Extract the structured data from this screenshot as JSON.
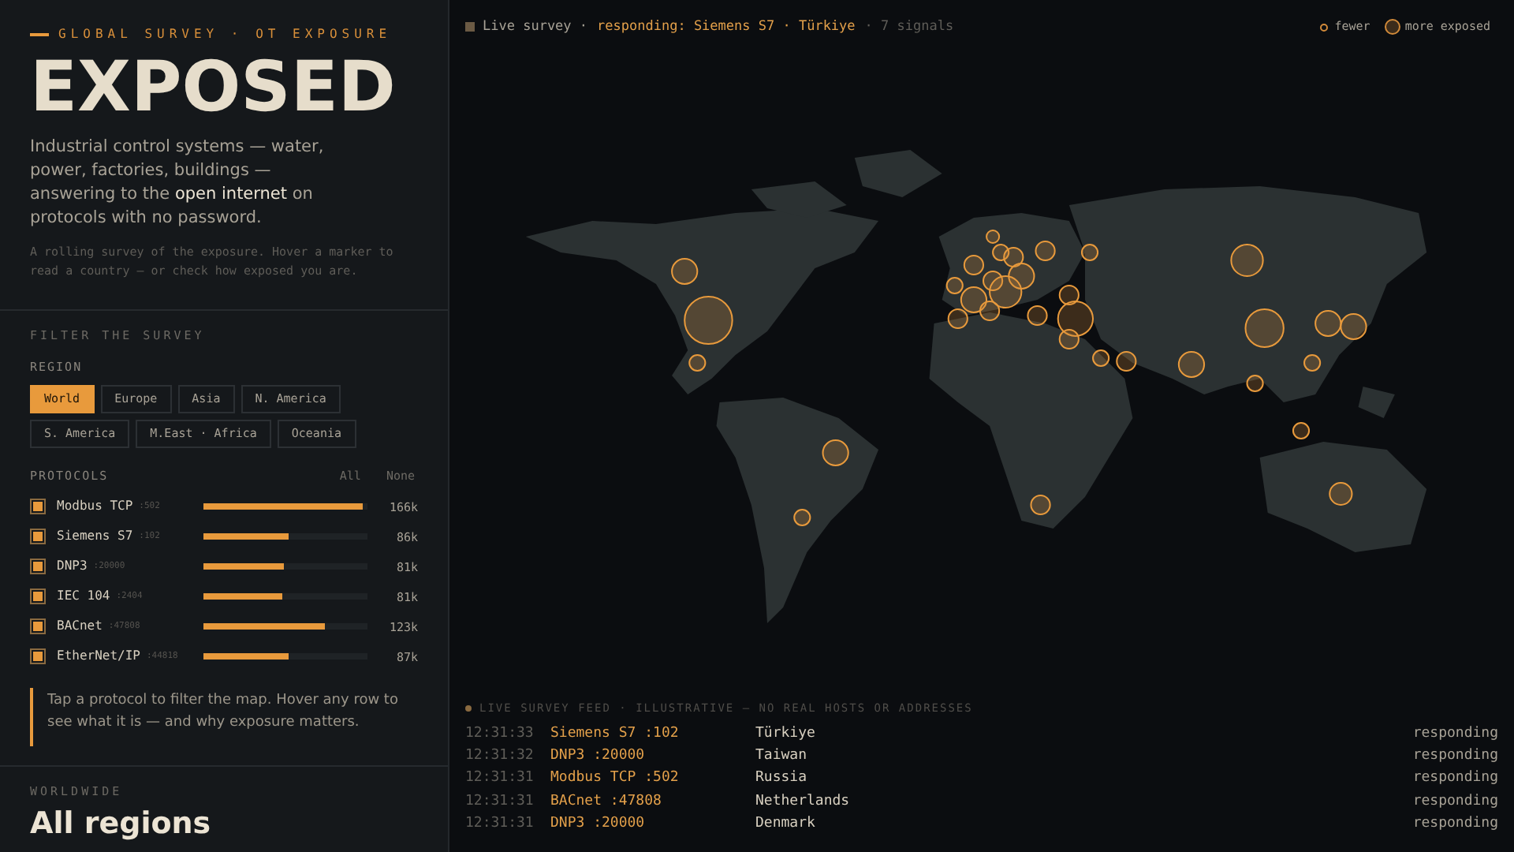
{
  "sidebar": {
    "kicker": "GLOBAL SURVEY · OT EXPOSURE",
    "title": "EXPOSED",
    "intro": "Industrial control systems — water, power, factories, buildings — answering to the **open internet** on protocols with no password.",
    "note": "A rolling survey of the exposure. Hover a marker to read a country — or check how exposed you are.",
    "filter_heading": "FILTER THE SURVEY",
    "region_label": "REGION",
    "regions": [
      {
        "label": "World",
        "selected": true
      },
      {
        "label": "Europe",
        "selected": false
      },
      {
        "label": "Asia",
        "selected": false
      },
      {
        "label": "N. America",
        "selected": false
      },
      {
        "label": "S. America",
        "selected": false
      },
      {
        "label": "M.East · Africa",
        "selected": false
      },
      {
        "label": "Oceania",
        "selected": false
      }
    ],
    "protocols_label": "PROTOCOLS",
    "all_link": "All",
    "none_link": "None",
    "protocols": [
      {
        "name": "Modbus TCP",
        "port": ":502",
        "checked": true,
        "level": 0.97,
        "count": "166k"
      },
      {
        "name": "Siemens S7",
        "port": ":102",
        "checked": true,
        "level": 0.52,
        "count": "86k"
      },
      {
        "name": "DNP3",
        "port": ":20000",
        "checked": true,
        "level": 0.49,
        "count": "81k"
      },
      {
        "name": "IEC 104",
        "port": ":2404",
        "checked": true,
        "level": 0.48,
        "count": "81k"
      },
      {
        "name": "BACnet",
        "port": ":47808",
        "checked": true,
        "level": 0.74,
        "count": "123k"
      },
      {
        "name": "EtherNet/IP",
        "port": ":44818",
        "checked": true,
        "level": 0.52,
        "count": "87k"
      }
    ],
    "hint": "Tap a protocol to filter the map. Hover any row to see what it is — and why exposure matters.",
    "scope_label": "WORLDWIDE",
    "scope_title": "All regions"
  },
  "status": {
    "live": "Live survey ·",
    "responding": "responding: Siemens S7 · Türkiye",
    "signals": "· 7 signals",
    "legend_fewer": "fewer",
    "legend_more": "more exposed"
  },
  "feed": {
    "heading": "LIVE SURVEY FEED · ILLUSTRATIVE — NO REAL HOSTS OR ADDRESSES",
    "rows": [
      {
        "time": "12:31:33",
        "protocol": "Siemens S7 :102",
        "country": "Türkiye",
        "state": "responding"
      },
      {
        "time": "12:31:32",
        "protocol": "DNP3 :20000",
        "country": "Taiwan",
        "state": "responding"
      },
      {
        "time": "12:31:31",
        "protocol": "Modbus TCP :502",
        "country": "Russia",
        "state": "responding"
      },
      {
        "time": "12:31:31",
        "protocol": "BACnet :47808",
        "country": "Netherlands",
        "state": "responding"
      },
      {
        "time": "12:31:31",
        "protocol": "DNP3 :20000",
        "country": "Denmark",
        "state": "responding"
      }
    ]
  }
}
